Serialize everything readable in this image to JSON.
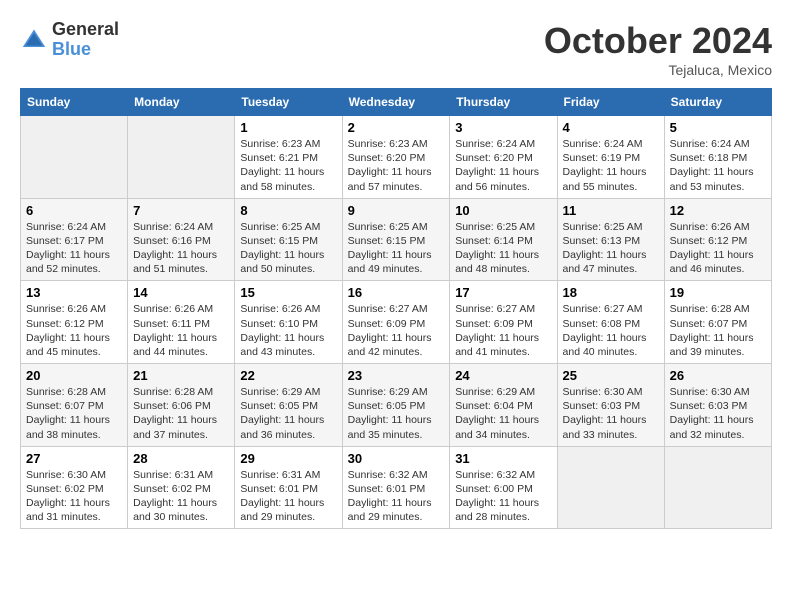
{
  "logo": {
    "line1": "General",
    "line2": "Blue"
  },
  "title": "October 2024",
  "subtitle": "Tejaluca, Mexico",
  "weekdays": [
    "Sunday",
    "Monday",
    "Tuesday",
    "Wednesday",
    "Thursday",
    "Friday",
    "Saturday"
  ],
  "weeks": [
    [
      {
        "day": "",
        "info": ""
      },
      {
        "day": "",
        "info": ""
      },
      {
        "day": "1",
        "info": "Sunrise: 6:23 AM\nSunset: 6:21 PM\nDaylight: 11 hours and 58 minutes."
      },
      {
        "day": "2",
        "info": "Sunrise: 6:23 AM\nSunset: 6:20 PM\nDaylight: 11 hours and 57 minutes."
      },
      {
        "day": "3",
        "info": "Sunrise: 6:24 AM\nSunset: 6:20 PM\nDaylight: 11 hours and 56 minutes."
      },
      {
        "day": "4",
        "info": "Sunrise: 6:24 AM\nSunset: 6:19 PM\nDaylight: 11 hours and 55 minutes."
      },
      {
        "day": "5",
        "info": "Sunrise: 6:24 AM\nSunset: 6:18 PM\nDaylight: 11 hours and 53 minutes."
      }
    ],
    [
      {
        "day": "6",
        "info": "Sunrise: 6:24 AM\nSunset: 6:17 PM\nDaylight: 11 hours and 52 minutes."
      },
      {
        "day": "7",
        "info": "Sunrise: 6:24 AM\nSunset: 6:16 PM\nDaylight: 11 hours and 51 minutes."
      },
      {
        "day": "8",
        "info": "Sunrise: 6:25 AM\nSunset: 6:15 PM\nDaylight: 11 hours and 50 minutes."
      },
      {
        "day": "9",
        "info": "Sunrise: 6:25 AM\nSunset: 6:15 PM\nDaylight: 11 hours and 49 minutes."
      },
      {
        "day": "10",
        "info": "Sunrise: 6:25 AM\nSunset: 6:14 PM\nDaylight: 11 hours and 48 minutes."
      },
      {
        "day": "11",
        "info": "Sunrise: 6:25 AM\nSunset: 6:13 PM\nDaylight: 11 hours and 47 minutes."
      },
      {
        "day": "12",
        "info": "Sunrise: 6:26 AM\nSunset: 6:12 PM\nDaylight: 11 hours and 46 minutes."
      }
    ],
    [
      {
        "day": "13",
        "info": "Sunrise: 6:26 AM\nSunset: 6:12 PM\nDaylight: 11 hours and 45 minutes."
      },
      {
        "day": "14",
        "info": "Sunrise: 6:26 AM\nSunset: 6:11 PM\nDaylight: 11 hours and 44 minutes."
      },
      {
        "day": "15",
        "info": "Sunrise: 6:26 AM\nSunset: 6:10 PM\nDaylight: 11 hours and 43 minutes."
      },
      {
        "day": "16",
        "info": "Sunrise: 6:27 AM\nSunset: 6:09 PM\nDaylight: 11 hours and 42 minutes."
      },
      {
        "day": "17",
        "info": "Sunrise: 6:27 AM\nSunset: 6:09 PM\nDaylight: 11 hours and 41 minutes."
      },
      {
        "day": "18",
        "info": "Sunrise: 6:27 AM\nSunset: 6:08 PM\nDaylight: 11 hours and 40 minutes."
      },
      {
        "day": "19",
        "info": "Sunrise: 6:28 AM\nSunset: 6:07 PM\nDaylight: 11 hours and 39 minutes."
      }
    ],
    [
      {
        "day": "20",
        "info": "Sunrise: 6:28 AM\nSunset: 6:07 PM\nDaylight: 11 hours and 38 minutes."
      },
      {
        "day": "21",
        "info": "Sunrise: 6:28 AM\nSunset: 6:06 PM\nDaylight: 11 hours and 37 minutes."
      },
      {
        "day": "22",
        "info": "Sunrise: 6:29 AM\nSunset: 6:05 PM\nDaylight: 11 hours and 36 minutes."
      },
      {
        "day": "23",
        "info": "Sunrise: 6:29 AM\nSunset: 6:05 PM\nDaylight: 11 hours and 35 minutes."
      },
      {
        "day": "24",
        "info": "Sunrise: 6:29 AM\nSunset: 6:04 PM\nDaylight: 11 hours and 34 minutes."
      },
      {
        "day": "25",
        "info": "Sunrise: 6:30 AM\nSunset: 6:03 PM\nDaylight: 11 hours and 33 minutes."
      },
      {
        "day": "26",
        "info": "Sunrise: 6:30 AM\nSunset: 6:03 PM\nDaylight: 11 hours and 32 minutes."
      }
    ],
    [
      {
        "day": "27",
        "info": "Sunrise: 6:30 AM\nSunset: 6:02 PM\nDaylight: 11 hours and 31 minutes."
      },
      {
        "day": "28",
        "info": "Sunrise: 6:31 AM\nSunset: 6:02 PM\nDaylight: 11 hours and 30 minutes."
      },
      {
        "day": "29",
        "info": "Sunrise: 6:31 AM\nSunset: 6:01 PM\nDaylight: 11 hours and 29 minutes."
      },
      {
        "day": "30",
        "info": "Sunrise: 6:32 AM\nSunset: 6:01 PM\nDaylight: 11 hours and 29 minutes."
      },
      {
        "day": "31",
        "info": "Sunrise: 6:32 AM\nSunset: 6:00 PM\nDaylight: 11 hours and 28 minutes."
      },
      {
        "day": "",
        "info": ""
      },
      {
        "day": "",
        "info": ""
      }
    ]
  ]
}
